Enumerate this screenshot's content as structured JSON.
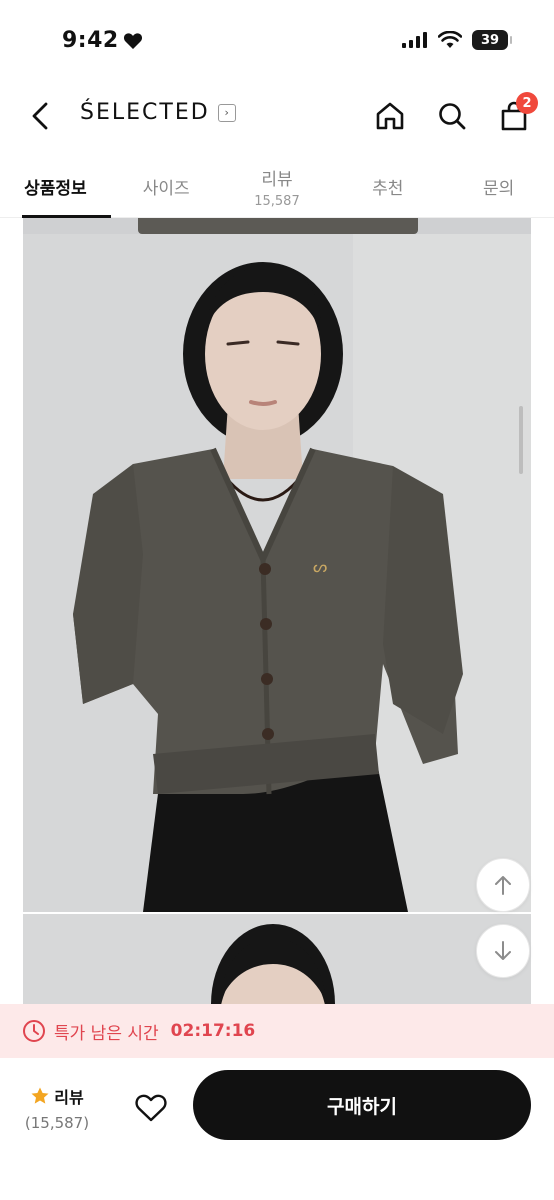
{
  "status_bar": {
    "time": "9:42",
    "battery": "39"
  },
  "header": {
    "brand": "ŚELECTED",
    "cart_count": "2"
  },
  "tabs": [
    {
      "label": "상품정보",
      "sub": ""
    },
    {
      "label": "사이즈",
      "sub": ""
    },
    {
      "label": "리뷰",
      "sub": "15,587"
    },
    {
      "label": "추천",
      "sub": ""
    },
    {
      "label": "문의",
      "sub": ""
    }
  ],
  "timer": {
    "label": "특가 남은 시간",
    "value": "02:17:16"
  },
  "bottom": {
    "review_label": "리뷰",
    "review_count": "(15,587)",
    "buy_label": "구매하기"
  },
  "colors": {
    "accent": "#111111",
    "badge": "#f0493c",
    "timer_text": "#e0454f",
    "timer_bg": "#fde9e9"
  }
}
